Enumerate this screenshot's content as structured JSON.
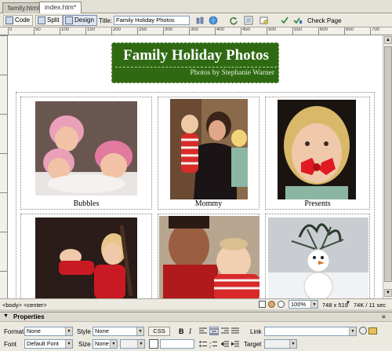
{
  "tabs": [
    {
      "label": "family.html"
    },
    {
      "label": "index.htm*"
    }
  ],
  "toolbar": {
    "code_label": "Code",
    "split_label": "Split",
    "design_label": "Design",
    "title_label": "Title:",
    "title_value": "Family Holiday Photos",
    "check_page_label": "Check Page"
  },
  "ruler": {
    "top_marks": [
      "0",
      "50",
      "100",
      "150",
      "200",
      "250",
      "300",
      "350",
      "400",
      "450",
      "500",
      "550",
      "600",
      "650",
      "700"
    ]
  },
  "page": {
    "banner_title": "Family Holiday Photos",
    "banner_subtitle": "Photos by Stephanie Warner",
    "photos": [
      {
        "caption": "Bubbles"
      },
      {
        "caption": "Mommy"
      },
      {
        "caption": "Presents"
      },
      {
        "caption": ""
      },
      {
        "caption": ""
      },
      {
        "caption": ""
      }
    ]
  },
  "status": {
    "tags": "<body> <center>",
    "zoom": "100%",
    "window_size": "748 x 519",
    "download": "74K / 11 sec"
  },
  "properties": {
    "header_label": "Properties",
    "format_label": "Format",
    "format_value": "None",
    "style_label": "Style",
    "style_value": "None",
    "css_label": "CSS",
    "bold_label": "B",
    "italic_label": "I",
    "link_label": "Link",
    "font_label": "Font",
    "font_value": "Default Font",
    "size_label": "Size",
    "size_value": "None",
    "target_label": "Target"
  },
  "colors": {
    "banner_bg": "#2f6a13",
    "canvas_bg": "#ffffff",
    "chrome_bg": "#ece9e1"
  }
}
